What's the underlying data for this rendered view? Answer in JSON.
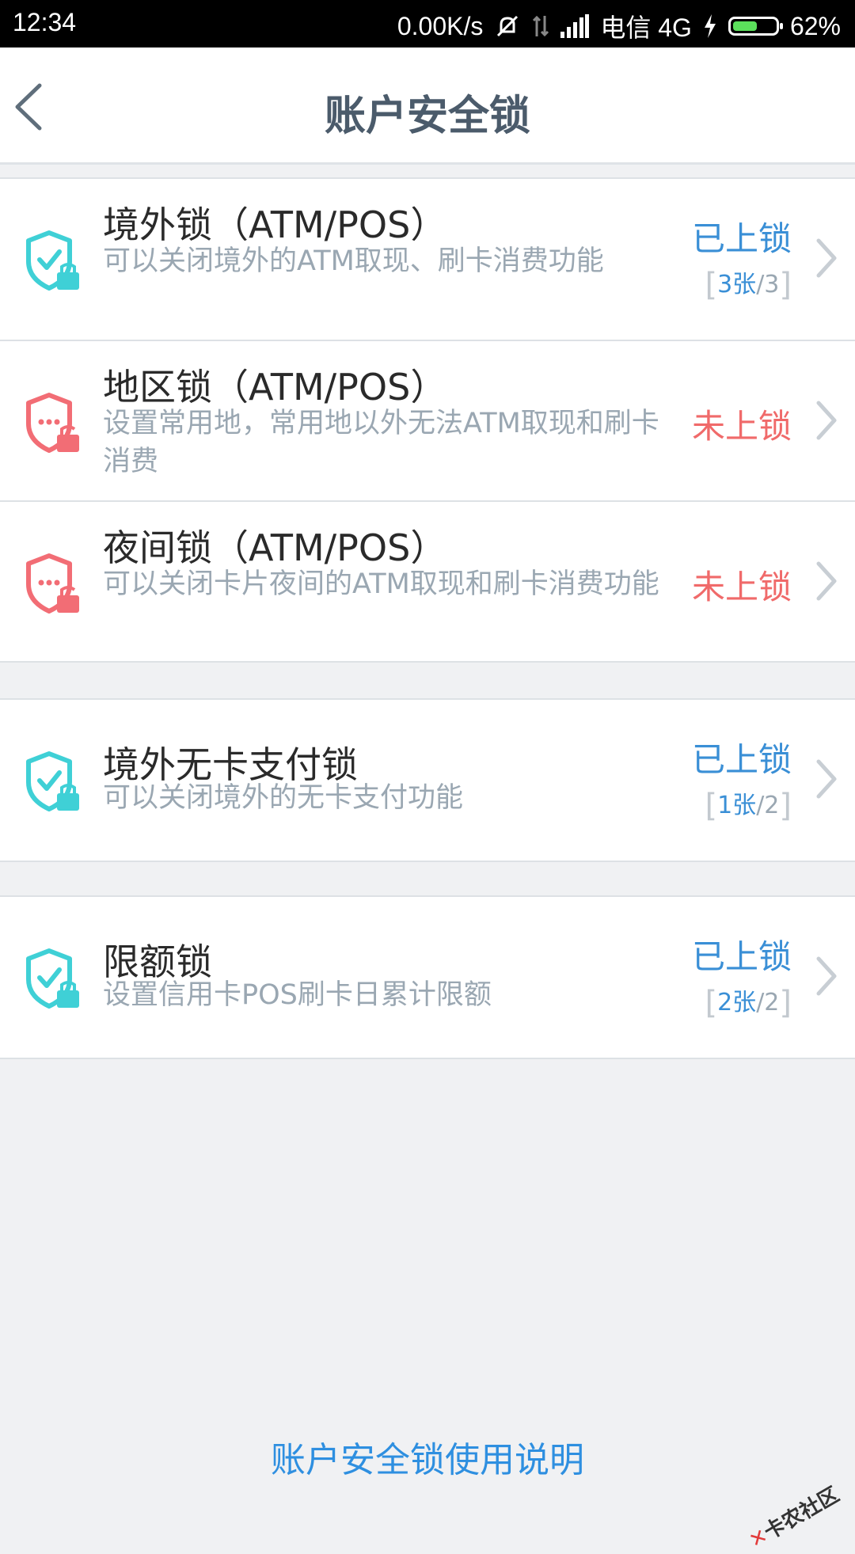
{
  "status_bar": {
    "time": "12:34",
    "speed": "0.00K/s",
    "carrier": "电信 4G",
    "battery": "62%",
    "battery_level": 0.62
  },
  "header": {
    "title": "账户安全锁"
  },
  "colors": {
    "locked": "#3a8fd6",
    "unlocked": "#f06a6a",
    "shield_locked": "#3fd0d6",
    "shield_unlocked": "#f26d75"
  },
  "locks": [
    {
      "name": "境外锁（ATM/POS）",
      "desc": "可以关闭境外的ATM取现、刷卡消费功能",
      "status": "已上锁",
      "count": "3张",
      "total": "/3",
      "state": "locked"
    },
    {
      "name": "地区锁（ATM/POS）",
      "desc": "设置常用地，常用地以外无法ATM取现和刷卡消费",
      "status": "未上锁",
      "state": "unlocked"
    },
    {
      "name": "夜间锁（ATM/POS）",
      "desc": "可以关闭卡片夜间的ATM取现和刷卡消费功能",
      "status": "未上锁",
      "state": "unlocked"
    },
    {
      "name": "境外无卡支付锁",
      "desc": "可以关闭境外的无卡支付功能",
      "status": "已上锁",
      "count": "1张",
      "total": "/2",
      "state": "locked"
    },
    {
      "name": "限额锁",
      "desc": "设置信用卡POS刷卡日累计限额",
      "status": "已上锁",
      "count": "2张",
      "total": "/2",
      "state": "locked"
    }
  ],
  "footer": {
    "help_link": "账户安全锁使用说明",
    "watermark": "卡农社区"
  }
}
